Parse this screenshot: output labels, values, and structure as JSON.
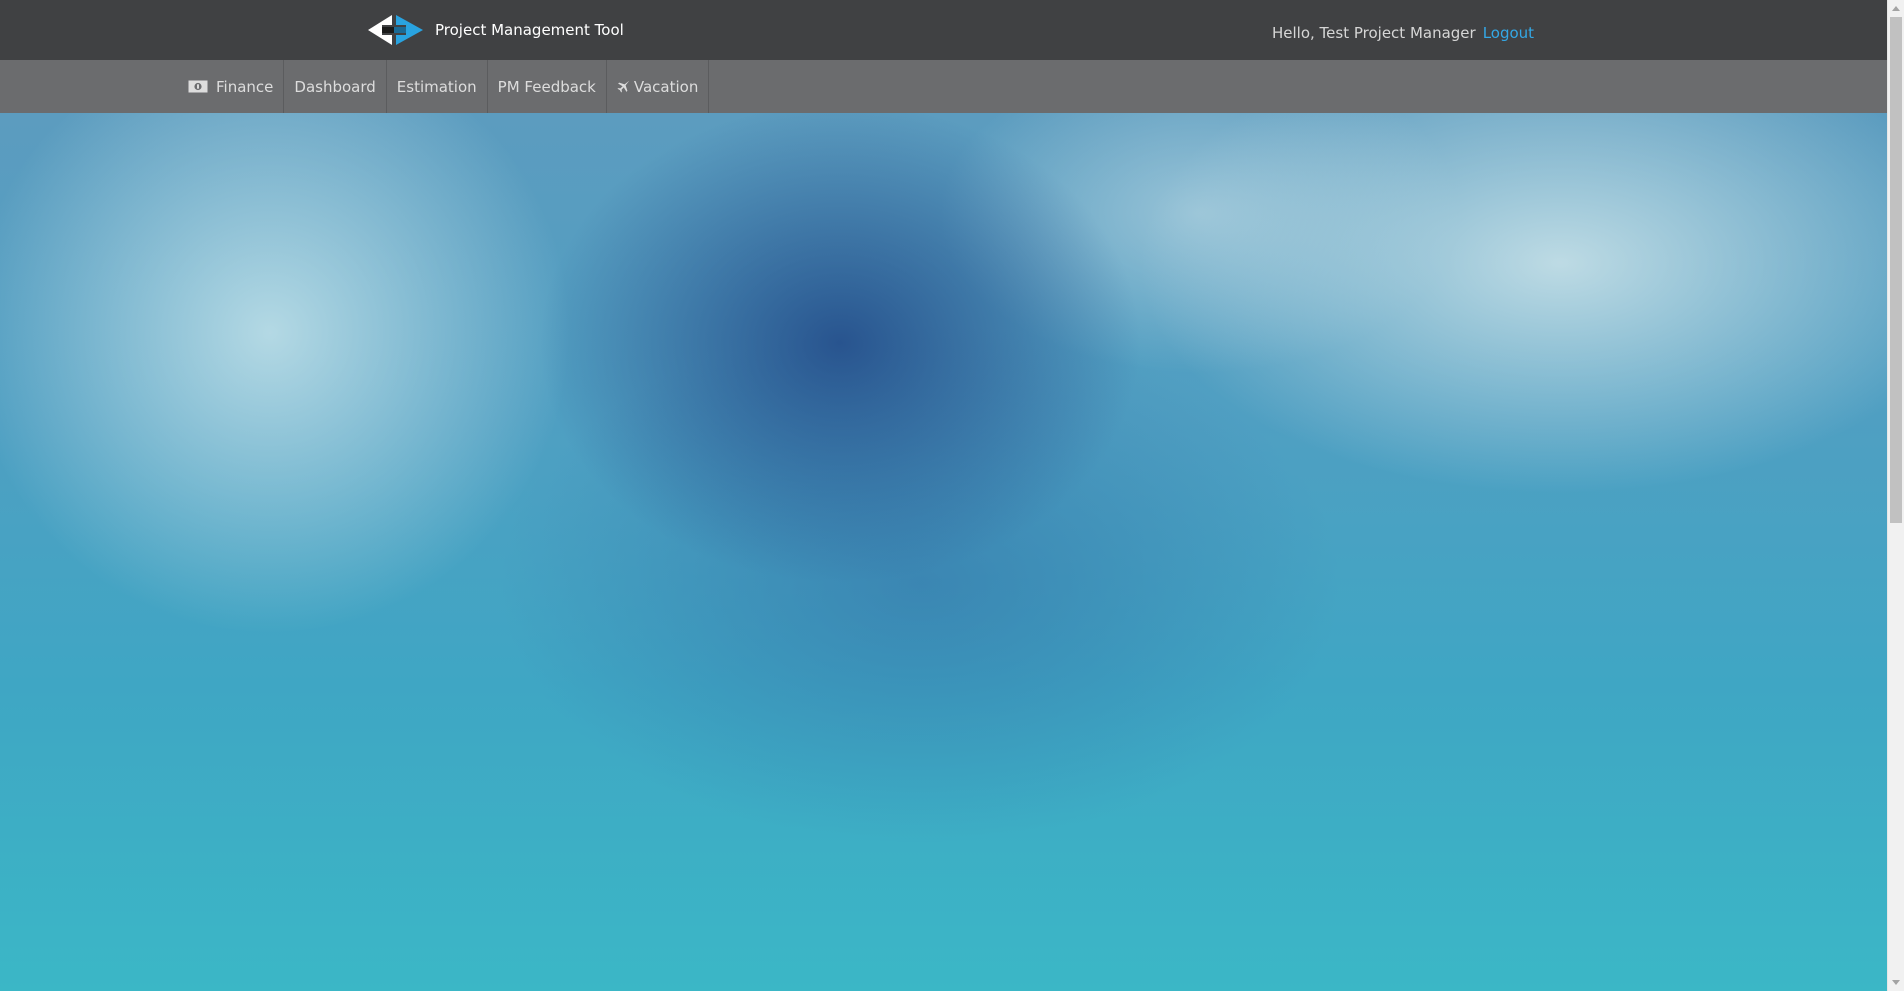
{
  "header": {
    "app_title": "Project Management Tool",
    "greeting": "Hello, Test Project Manager",
    "logout_label": "Logout",
    "logo_icon": "double-arrow-logo-icon"
  },
  "nav": {
    "items": [
      {
        "label": "Finance",
        "icon": "money-icon"
      },
      {
        "label": "Dashboard"
      },
      {
        "label": "Estimation"
      },
      {
        "label": "PM Feedback"
      },
      {
        "label": "Vacation",
        "icon": "plane-icon"
      }
    ]
  },
  "colors": {
    "header_bg": "#404143",
    "nav_bg": "#6b6c6e",
    "link": "#34a8e6",
    "logo_accent": "#29a3e0"
  }
}
